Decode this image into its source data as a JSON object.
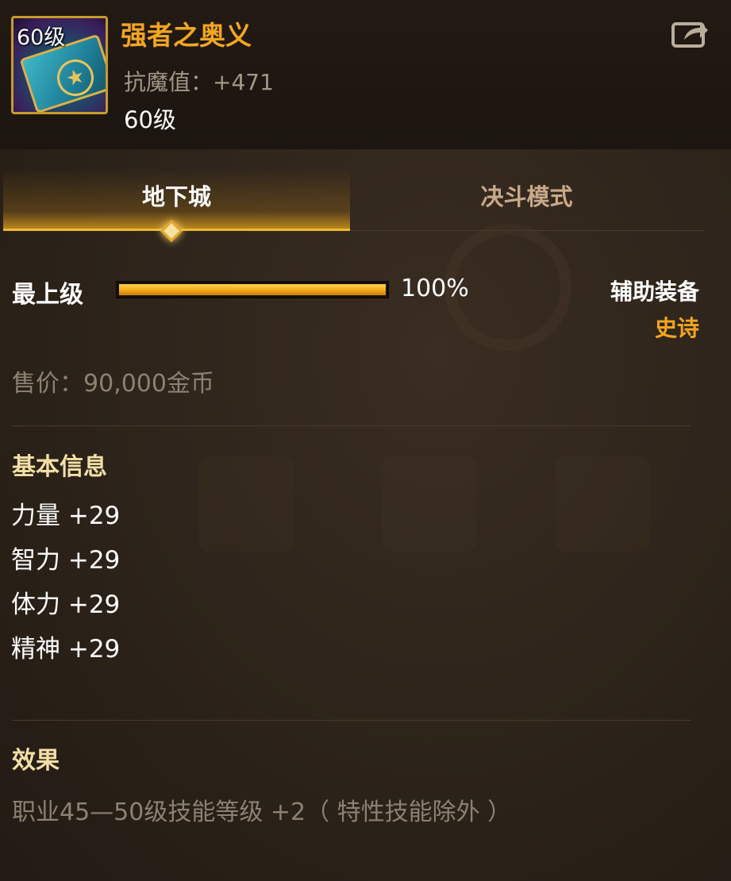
{
  "item": {
    "name": "强者之奥义",
    "icon_level_badge": "60级",
    "stat_line": "抗魔值：+471",
    "level": "60级",
    "icon": "spellbook-icon"
  },
  "share": {
    "icon": "share-icon"
  },
  "tabs": [
    {
      "label": "地下城",
      "active": true
    },
    {
      "label": "决斗模式",
      "active": false
    }
  ],
  "grade": {
    "label": "最上级",
    "percent_text": "100%",
    "progress": 1.0
  },
  "equip": {
    "type": "辅助装备",
    "rarity": "史诗"
  },
  "price": "售价：90,000金币",
  "basic_info": {
    "title": "基本信息",
    "stats": [
      "力量 +29",
      "智力 +29",
      "体力 +29",
      "精神 +29"
    ]
  },
  "effect": {
    "title": "效果",
    "text": "职业45—50级技能等级 +2（ 特性技能除外 ）"
  },
  "colors": {
    "accent_gold": "#f3a622",
    "title_cream": "#f3dfa6",
    "muted_text": "#8c8272",
    "bar_fill": "#f2a818"
  }
}
